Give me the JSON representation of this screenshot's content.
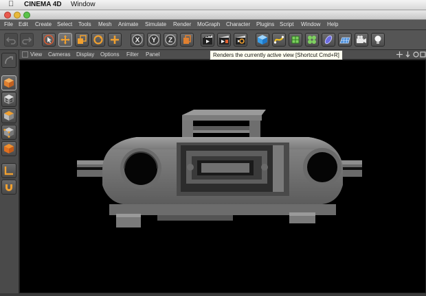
{
  "os_menu": {
    "app_name": "CINEMA 4D",
    "window_menu": "Window"
  },
  "menu": {
    "items": [
      "File",
      "Edit",
      "Create",
      "Select",
      "Tools",
      "Mesh",
      "Animate",
      "Simulate",
      "Render",
      "MoGraph",
      "Character",
      "Plugins",
      "Script",
      "Window",
      "Help"
    ]
  },
  "viewport_menu": {
    "items": [
      "View",
      "Cameras",
      "Display",
      "Options",
      "Filter",
      "Panel"
    ]
  },
  "tooltip": {
    "text": "Renders the currently active view [Shortcut Cmd+R]"
  },
  "toolbar": {
    "axis_x": "X",
    "axis_y": "Y",
    "axis_z": "Z",
    "icons": [
      "undo-icon",
      "redo-icon",
      "live-selection-icon",
      "move-icon",
      "scale-icon",
      "rotate-icon",
      "add-object-icon",
      "x-axis-icon",
      "y-axis-icon",
      "z-axis-icon",
      "coordinate-system-icon",
      "render-view-icon",
      "render-picture-viewer-icon",
      "edit-render-settings-icon",
      "cube-icon",
      "spline-pen-icon",
      "subdivision-surface-icon",
      "cloner-icon",
      "deformer-icon",
      "floor-icon",
      "camera-icon",
      "light-icon"
    ]
  },
  "left_palette": {
    "icons": [
      "make-editable-icon",
      "model-mode-icon",
      "texture-mode-icon",
      "workplane-icon",
      "points-mode-icon",
      "edges-mode-icon",
      "axis-mode-icon",
      "snap-icon"
    ]
  },
  "colors": {
    "accent": "#f0a030",
    "viewport_bg": "#000000",
    "model_gray": "#7a7a7a"
  }
}
